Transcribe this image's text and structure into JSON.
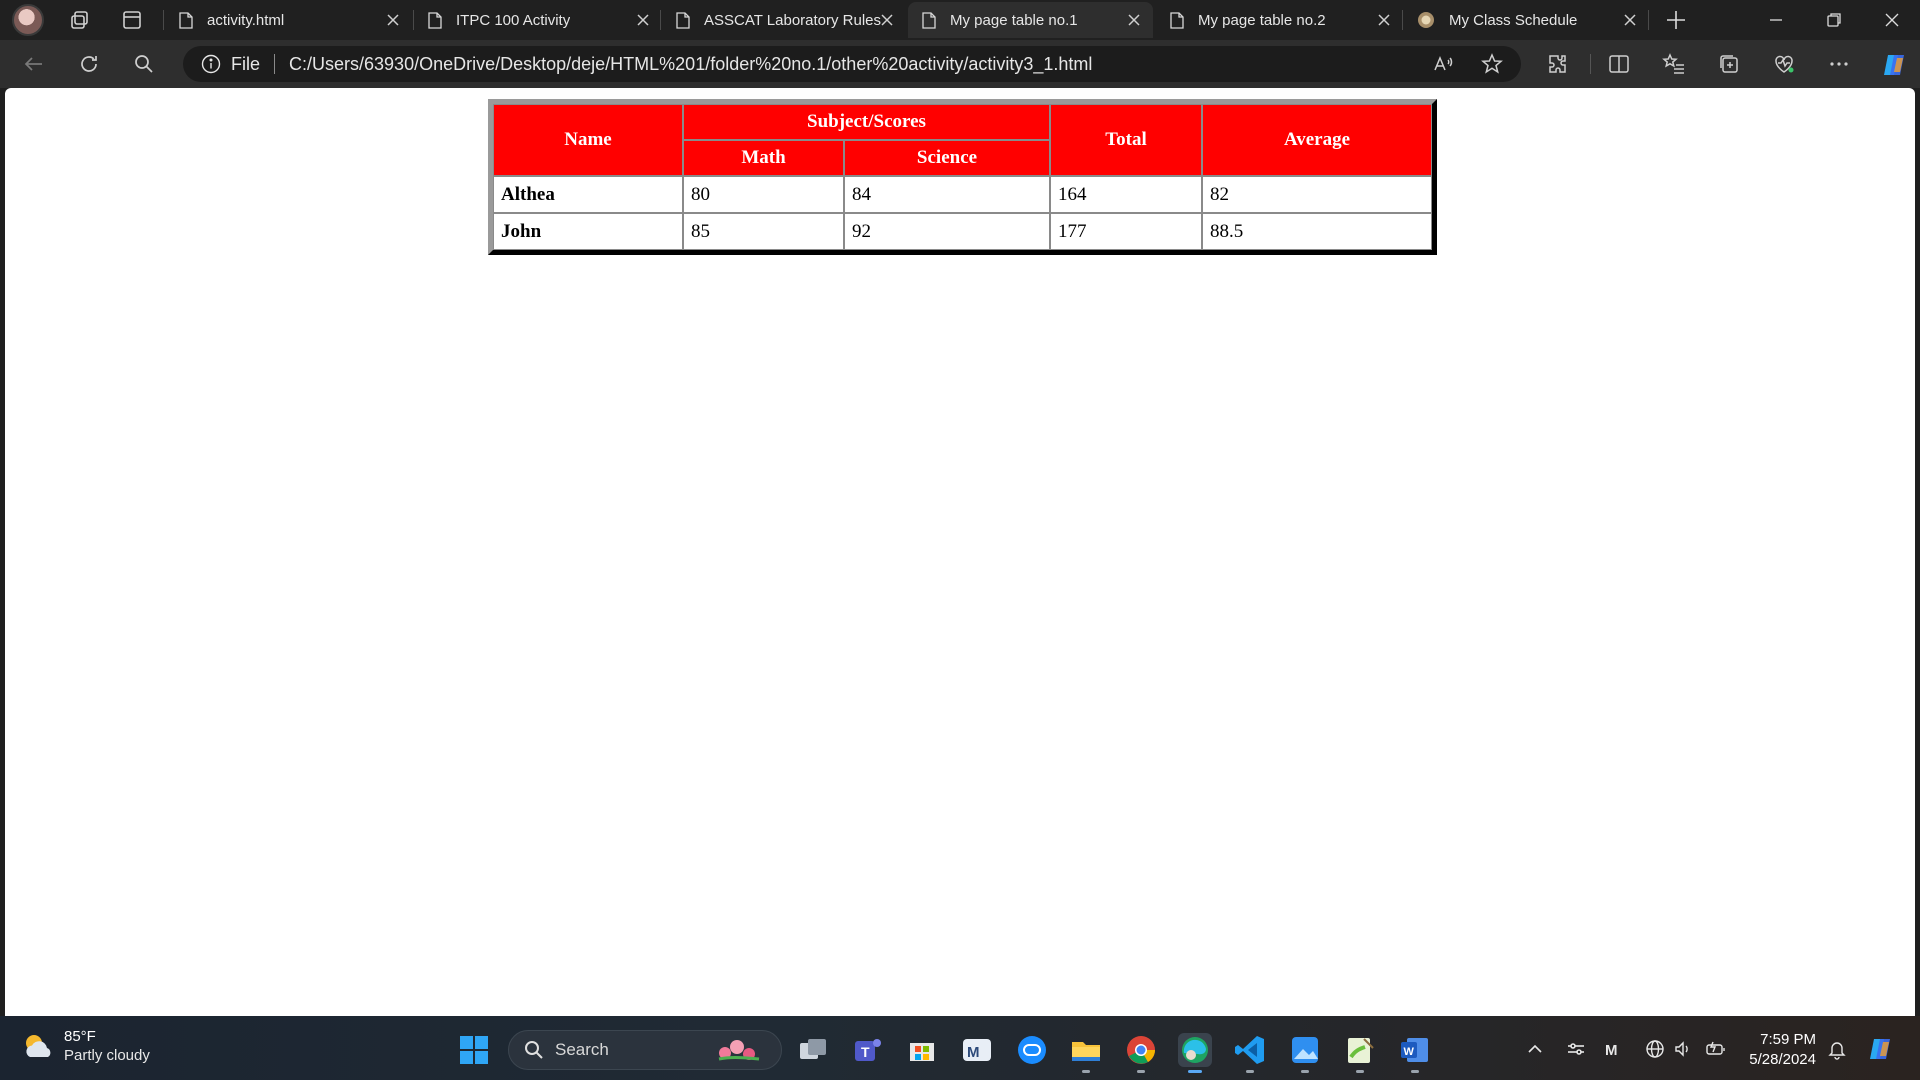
{
  "browser": {
    "tabs": [
      {
        "label": "activity.html",
        "active": false
      },
      {
        "label": "ITPC 100 Activity",
        "active": false
      },
      {
        "label": "ASSCAT Laboratory Rules",
        "active": false
      },
      {
        "label": "My page table no.1",
        "active": true
      },
      {
        "label": "My page table no.2",
        "active": false
      },
      {
        "label": "My Class Schedule",
        "active": false
      }
    ],
    "address": {
      "scheme_label": "File",
      "url": "C:/Users/63930/OneDrive/Desktop/deje/HTML%201/folder%20no.1/other%20activity/activity3_1.html"
    }
  },
  "table": {
    "headers": {
      "name": "Name",
      "subject_scores": "Subject/Scores",
      "math": "Math",
      "science": "Science",
      "total": "Total",
      "average": "Average"
    },
    "rows": [
      {
        "name": "Althea",
        "math": "80",
        "science": "84",
        "total": "164",
        "average": "82"
      },
      {
        "name": "John",
        "math": "85",
        "science": "92",
        "total": "177",
        "average": "88.5"
      }
    ]
  },
  "taskbar": {
    "weather": {
      "temp": "85°F",
      "condition": "Partly cloudy"
    },
    "search_label": "Search",
    "clock": {
      "time": "7:59 PM",
      "date": "5/28/2024"
    }
  },
  "colors": {
    "table_header_bg": "#ff0000",
    "table_header_text": "#ffffff",
    "chrome_bg": "#202020",
    "toolbar_bg": "#2e2e2e"
  }
}
